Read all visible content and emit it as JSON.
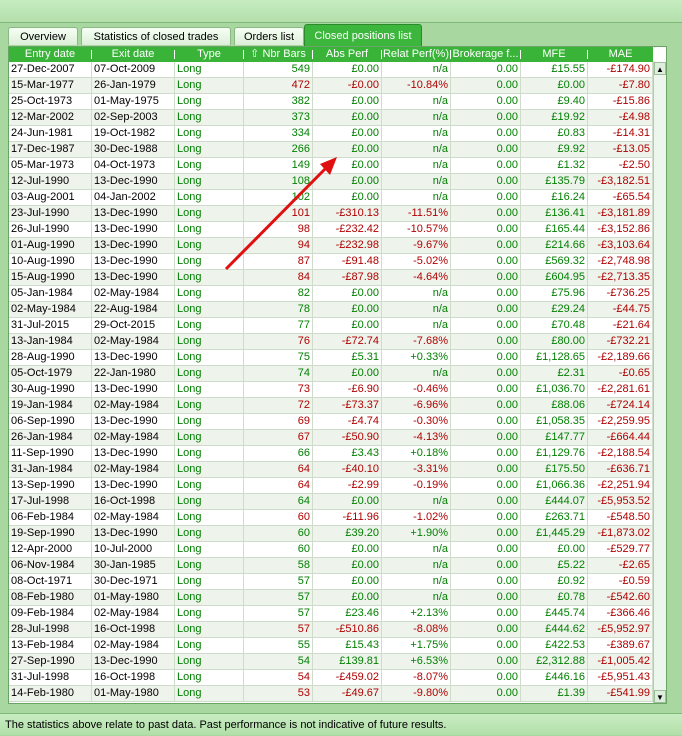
{
  "tabs": [
    {
      "label": "Overview",
      "active": false
    },
    {
      "label": "Statistics of closed trades",
      "active": false
    },
    {
      "label": "Orders list",
      "active": false
    },
    {
      "label": "Closed positions list",
      "active": true
    }
  ],
  "columns": [
    "Entry date",
    "Exit date",
    "Type",
    "Nbr Bars",
    "Abs Perf",
    "Relat Perf(%)",
    "Brokerage f...",
    "MFE",
    "MAE"
  ],
  "sort_icon": "sort-up-icon",
  "rows": [
    [
      "27-Dec-2007",
      "07-Oct-2009",
      "Long",
      "549",
      "£0.00",
      "n/a",
      "0.00",
      "£15.55",
      "-£174.90"
    ],
    [
      "15-Mar-1977",
      "26-Jan-1979",
      "Long",
      "472",
      "-£0.00",
      "-10.84%",
      "0.00",
      "£0.00",
      "-£7.80"
    ],
    [
      "25-Oct-1973",
      "01-May-1975",
      "Long",
      "382",
      "£0.00",
      "n/a",
      "0.00",
      "£9.40",
      "-£15.86"
    ],
    [
      "12-Mar-2002",
      "02-Sep-2003",
      "Long",
      "373",
      "£0.00",
      "n/a",
      "0.00",
      "£19.92",
      "-£4.98"
    ],
    [
      "24-Jun-1981",
      "19-Oct-1982",
      "Long",
      "334",
      "£0.00",
      "n/a",
      "0.00",
      "£0.83",
      "-£14.31"
    ],
    [
      "17-Dec-1987",
      "30-Dec-1988",
      "Long",
      "266",
      "£0.00",
      "n/a",
      "0.00",
      "£9.92",
      "-£13.05"
    ],
    [
      "05-Mar-1973",
      "04-Oct-1973",
      "Long",
      "149",
      "£0.00",
      "n/a",
      "0.00",
      "£1.32",
      "-£2.50"
    ],
    [
      "12-Jul-1990",
      "13-Dec-1990",
      "Long",
      "108",
      "£0.00",
      "n/a",
      "0.00",
      "£135.79",
      "-£3,182.51"
    ],
    [
      "03-Aug-2001",
      "04-Jan-2002",
      "Long",
      "102",
      "£0.00",
      "n/a",
      "0.00",
      "£16.24",
      "-£65.54"
    ],
    [
      "23-Jul-1990",
      "13-Dec-1990",
      "Long",
      "101",
      "-£310.13",
      "-11.51%",
      "0.00",
      "£136.41",
      "-£3,181.89"
    ],
    [
      "26-Jul-1990",
      "13-Dec-1990",
      "Long",
      "98",
      "-£232.42",
      "-10.57%",
      "0.00",
      "£165.44",
      "-£3,152.86"
    ],
    [
      "01-Aug-1990",
      "13-Dec-1990",
      "Long",
      "94",
      "-£232.98",
      "-9.67%",
      "0.00",
      "£214.66",
      "-£3,103.64"
    ],
    [
      "10-Aug-1990",
      "13-Dec-1990",
      "Long",
      "87",
      "-£91.48",
      "-5.02%",
      "0.00",
      "£569.32",
      "-£2,748.98"
    ],
    [
      "15-Aug-1990",
      "13-Dec-1990",
      "Long",
      "84",
      "-£87.98",
      "-4.64%",
      "0.00",
      "£604.95",
      "-£2,713.35"
    ],
    [
      "05-Jan-1984",
      "02-May-1984",
      "Long",
      "82",
      "£0.00",
      "n/a",
      "0.00",
      "£75.96",
      "-£736.25"
    ],
    [
      "02-May-1984",
      "22-Aug-1984",
      "Long",
      "78",
      "£0.00",
      "n/a",
      "0.00",
      "£29.24",
      "-£44.75"
    ],
    [
      "31-Jul-2015",
      "29-Oct-2015",
      "Long",
      "77",
      "£0.00",
      "n/a",
      "0.00",
      "£70.48",
      "-£21.64"
    ],
    [
      "13-Jan-1984",
      "02-May-1984",
      "Long",
      "76",
      "-£72.74",
      "-7.68%",
      "0.00",
      "£80.00",
      "-£732.21"
    ],
    [
      "28-Aug-1990",
      "13-Dec-1990",
      "Long",
      "75",
      "£5.31",
      "+0.33%",
      "0.00",
      "£1,128.65",
      "-£2,189.66"
    ],
    [
      "05-Oct-1979",
      "22-Jan-1980",
      "Long",
      "74",
      "£0.00",
      "n/a",
      "0.00",
      "£2.31",
      "-£0.65"
    ],
    [
      "30-Aug-1990",
      "13-Dec-1990",
      "Long",
      "73",
      "-£6.90",
      "-0.46%",
      "0.00",
      "£1,036.70",
      "-£2,281.61"
    ],
    [
      "19-Jan-1984",
      "02-May-1984",
      "Long",
      "72",
      "-£73.37",
      "-6.96%",
      "0.00",
      "£88.06",
      "-£724.14"
    ],
    [
      "06-Sep-1990",
      "13-Dec-1990",
      "Long",
      "69",
      "-£4.74",
      "-0.30%",
      "0.00",
      "£1,058.35",
      "-£2,259.95"
    ],
    [
      "26-Jan-1984",
      "02-May-1984",
      "Long",
      "67",
      "-£50.90",
      "-4.13%",
      "0.00",
      "£147.77",
      "-£664.44"
    ],
    [
      "11-Sep-1990",
      "13-Dec-1990",
      "Long",
      "66",
      "£3.43",
      "+0.18%",
      "0.00",
      "£1,129.76",
      "-£2,188.54"
    ],
    [
      "31-Jan-1984",
      "02-May-1984",
      "Long",
      "64",
      "-£40.10",
      "-3.31%",
      "0.00",
      "£175.50",
      "-£636.71"
    ],
    [
      "13-Sep-1990",
      "13-Dec-1990",
      "Long",
      "64",
      "-£2.99",
      "-0.19%",
      "0.00",
      "£1,066.36",
      "-£2,251.94"
    ],
    [
      "17-Jul-1998",
      "16-Oct-1998",
      "Long",
      "64",
      "£0.00",
      "n/a",
      "0.00",
      "£444.07",
      "-£5,953.52"
    ],
    [
      "06-Feb-1984",
      "02-May-1984",
      "Long",
      "60",
      "-£11.96",
      "-1.02%",
      "0.00",
      "£263.71",
      "-£548.50"
    ],
    [
      "19-Sep-1990",
      "13-Dec-1990",
      "Long",
      "60",
      "£39.20",
      "+1.90%",
      "0.00",
      "£1,445.29",
      "-£1,873.02"
    ],
    [
      "12-Apr-2000",
      "10-Jul-2000",
      "Long",
      "60",
      "£0.00",
      "n/a",
      "0.00",
      "£0.00",
      "-£529.77"
    ],
    [
      "06-Nov-1984",
      "30-Jan-1985",
      "Long",
      "58",
      "£0.00",
      "n/a",
      "0.00",
      "£5.22",
      "-£2.65"
    ],
    [
      "08-Oct-1971",
      "30-Dec-1971",
      "Long",
      "57",
      "£0.00",
      "n/a",
      "0.00",
      "£0.92",
      "-£0.59"
    ],
    [
      "08-Feb-1980",
      "01-May-1980",
      "Long",
      "57",
      "£0.00",
      "n/a",
      "0.00",
      "£0.78",
      "-£542.60"
    ],
    [
      "09-Feb-1984",
      "02-May-1984",
      "Long",
      "57",
      "£23.46",
      "+2.13%",
      "0.00",
      "£445.74",
      "-£366.46"
    ],
    [
      "28-Jul-1998",
      "16-Oct-1998",
      "Long",
      "57",
      "-£510.86",
      "-8.08%",
      "0.00",
      "£444.62",
      "-£5,952.97"
    ],
    [
      "13-Feb-1984",
      "02-May-1984",
      "Long",
      "55",
      "£15.43",
      "+1.75%",
      "0.00",
      "£422.53",
      "-£389.67"
    ],
    [
      "27-Sep-1990",
      "13-Dec-1990",
      "Long",
      "54",
      "£139.81",
      "+6.53%",
      "0.00",
      "£2,312.88",
      "-£1,005.42"
    ],
    [
      "31-Jul-1998",
      "16-Oct-1998",
      "Long",
      "54",
      "-£459.02",
      "-8.07%",
      "0.00",
      "£446.16",
      "-£5,951.43"
    ],
    [
      "14-Feb-1980",
      "01-May-1980",
      "Long",
      "53",
      "-£49.67",
      "-9.80%",
      "0.00",
      "£1.39",
      "-£541.99"
    ]
  ],
  "scrollbar": {
    "up_icon": "scroll-up-icon",
    "down_icon": "scroll-down-icon"
  },
  "annotation": {
    "icon": "red-arrow-icon",
    "color": "#e01010"
  },
  "footer": {
    "text": "The statistics above relate to past data. Past performance is not indicative of future results."
  },
  "colors": {
    "header_bg": "#39b439",
    "negative": "#b00000",
    "positive": "#008000",
    "tab_active": "#3cb63c"
  }
}
